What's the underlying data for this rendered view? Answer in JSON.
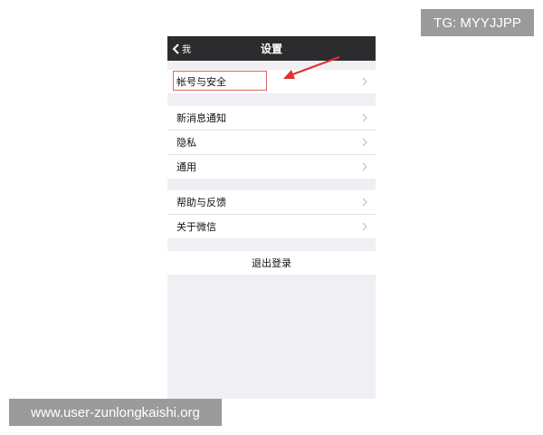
{
  "badge": {
    "text": "TG: MYYJJPP"
  },
  "navbar": {
    "back_label": "我",
    "title": "设置"
  },
  "groups": [
    {
      "items": [
        {
          "label": "帐号与安全",
          "icon": "chevron-right-icon"
        }
      ]
    },
    {
      "items": [
        {
          "label": "新消息通知",
          "icon": "chevron-right-icon"
        },
        {
          "label": "隐私",
          "icon": "chevron-right-icon"
        },
        {
          "label": "通用",
          "icon": "chevron-right-icon"
        }
      ]
    },
    {
      "items": [
        {
          "label": "帮助与反馈",
          "icon": "chevron-right-icon"
        },
        {
          "label": "关于微信",
          "icon": "chevron-right-icon"
        }
      ]
    }
  ],
  "logout_label": "退出登录",
  "watermark": {
    "text": "www.user-zunlongkaishi.org"
  },
  "colors": {
    "navbar": "#2c2c2e",
    "background": "#efeff4",
    "annotation": "#e03131",
    "badge": "#9b9b9b"
  }
}
